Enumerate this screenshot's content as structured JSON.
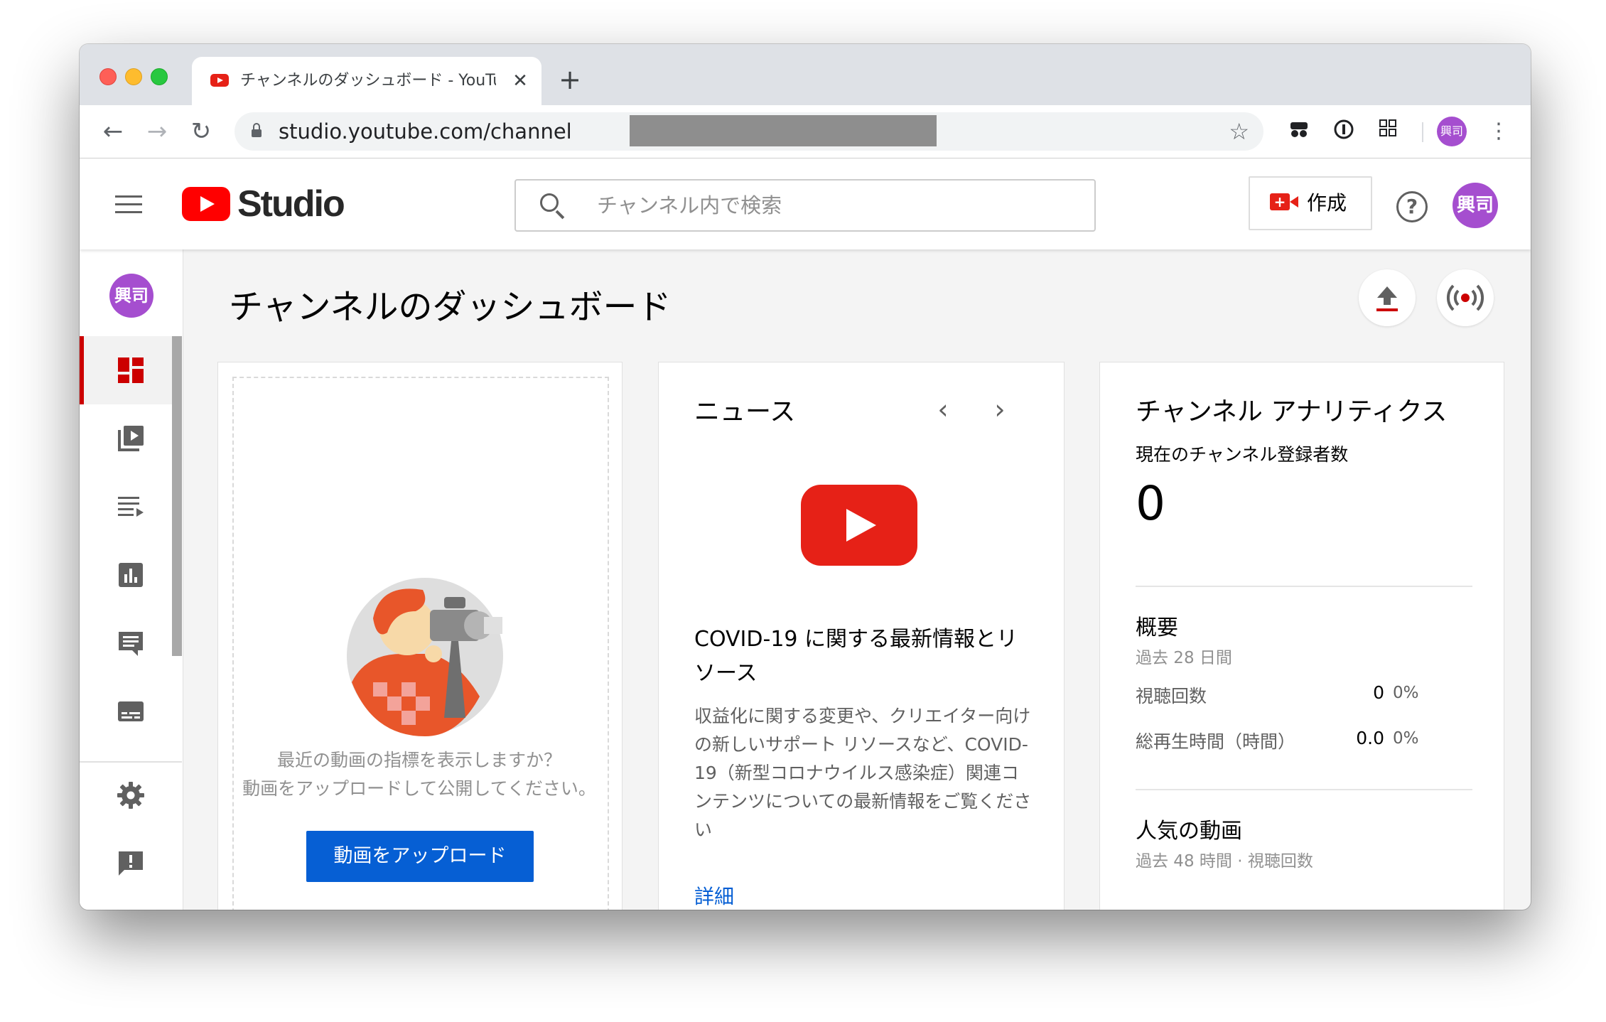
{
  "browser": {
    "tab_title": "チャンネルのダッシュボード - YouTube Studio",
    "url": "studio.youtube.com/channel",
    "new_tab_label": "+",
    "close_label": "✕",
    "avatar_text": "興司"
  },
  "header": {
    "logo_text": "Studio",
    "search_placeholder": "チャンネル内で検索",
    "create_label": "作成",
    "help_label": "?",
    "avatar_text": "興司"
  },
  "sidebar": {
    "avatar_text": "興司",
    "items": [
      {
        "icon": "dashboard-icon",
        "active": true
      },
      {
        "icon": "videos-icon",
        "active": false
      },
      {
        "icon": "playlists-icon",
        "active": false
      },
      {
        "icon": "analytics-icon",
        "active": false
      },
      {
        "icon": "comments-icon",
        "active": false
      },
      {
        "icon": "subtitles-icon",
        "active": false
      },
      {
        "icon": "settings-icon",
        "active": false
      },
      {
        "icon": "feedback-icon",
        "active": false
      }
    ]
  },
  "main": {
    "page_title": "チャンネルのダッシュボード",
    "upload_card": {
      "hint_line1": "最近の動画の指標を表示しますか？",
      "hint_line2": "動画をアップロードして公開してください。",
      "button_label": "動画をアップロード"
    },
    "news_card": {
      "title": "ニュース",
      "prev": "‹",
      "next": "›",
      "headline": "COVID-19 に関する最新情報とリソース",
      "body": "収益化に関する変更や、クリエイター向けの新しいサポート リソースなど、COVID-19（新型コロナウイルス感染症）関連コンテンツについての最新情報をご覧ください",
      "link": "詳細"
    },
    "analytics_card": {
      "title": "チャンネル アナリティクス",
      "subscribers_label": "現在のチャンネル登録者数",
      "subscribers_value": "0",
      "summary_title": "概要",
      "summary_period": "過去 28 日間",
      "rows": [
        {
          "label": "視聴回数",
          "value": "0",
          "pct": "0%"
        },
        {
          "label": "総再生時間（時間）",
          "value": "0.0",
          "pct": "0%"
        }
      ],
      "popular_title": "人気の動画",
      "popular_period": "過去 48 時間 · 視聴回数"
    }
  },
  "colors": {
    "accent_red": "#e62117",
    "button_blue": "#065fd4",
    "avatar_purple": "#a54ecf"
  }
}
